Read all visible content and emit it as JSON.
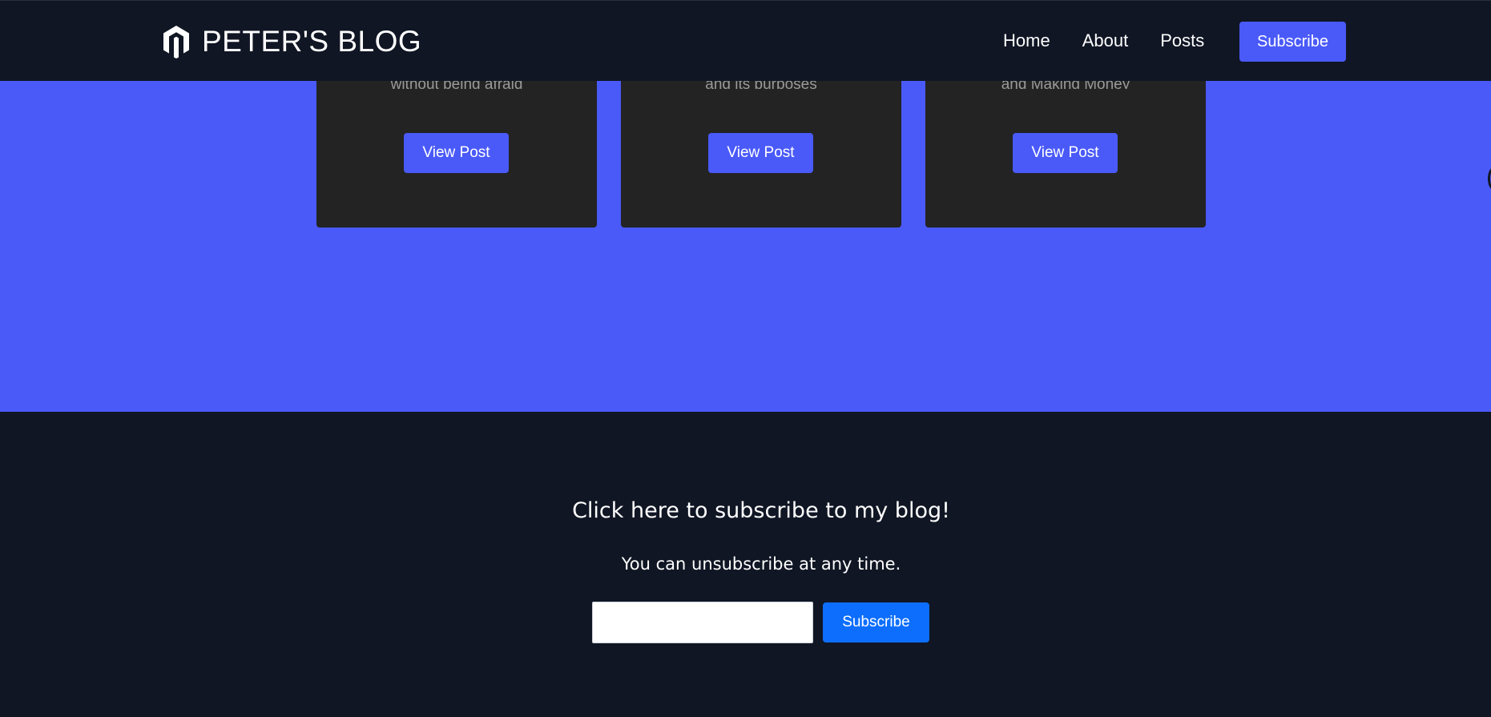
{
  "header": {
    "brand": "PETER'S BLOG",
    "brand_icon": "hexagon-logo-icon",
    "nav": [
      {
        "label": "Home"
      },
      {
        "label": "About"
      },
      {
        "label": "Posts"
      }
    ],
    "subscribe_label": "Subscribe"
  },
  "posts": [
    {
      "description": "without being afraid",
      "button_label": "View Post"
    },
    {
      "description": "and its purposes",
      "button_label": "View Post"
    },
    {
      "description": "and Making Money",
      "button_label": "View Post"
    }
  ],
  "footer": {
    "title": "Click here to subscribe to my blog!",
    "subtitle": "You can unsubscribe at any time.",
    "email_value": "",
    "email_placeholder": "",
    "subscribe_label": "Subscribe"
  },
  "colors": {
    "navy": "#101624",
    "accent": "#4a5af8",
    "card": "#232323",
    "primary_button": "#0d6efd"
  }
}
